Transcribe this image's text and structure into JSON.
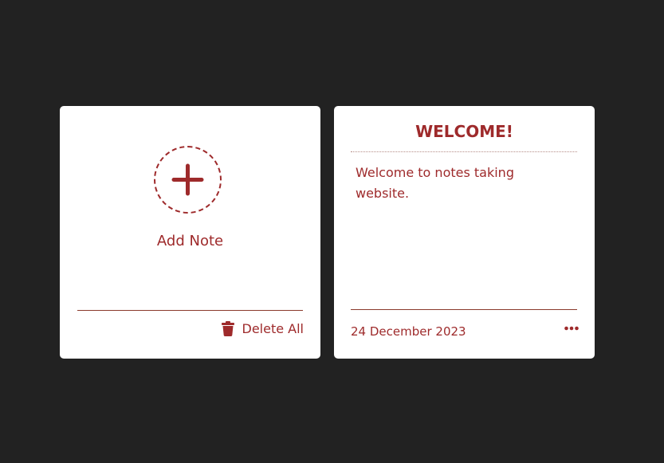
{
  "colors": {
    "background": "#222222",
    "card": "#ffffff",
    "accent": "#9e2a2b"
  },
  "add_card": {
    "add_icon": "plus-icon",
    "add_label": "Add Note",
    "delete_icon": "trash-icon",
    "delete_label": "Delete All"
  },
  "note_card": {
    "title": "WELCOME!",
    "body": "Welcome to notes taking website.",
    "date": "24 December 2023",
    "menu_icon": "more-horizontal-icon"
  }
}
